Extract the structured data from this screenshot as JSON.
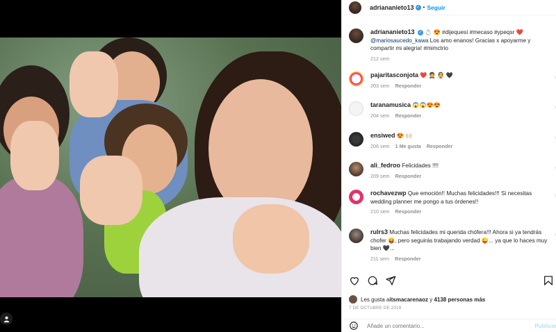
{
  "header": {
    "username": "adriananieto13",
    "follow_label": "Seguir"
  },
  "caption": {
    "username": "adriananieto13",
    "text_prefix": "💍 😍 #dijequesí #mecaso #ypeqsr ❤️ ",
    "mention": "@mariosaucedo_kawa",
    "text_suffix": " Los amo enanos! Gracias x apoyarme y compartir mi alegria! #mimctrio",
    "time": "212 sem"
  },
  "comments": [
    {
      "username": "pajaritasconjota",
      "text": "❤️ 🤵 👰 🖤",
      "time": "203 sem",
      "likes": "",
      "reply": "Responder"
    },
    {
      "username": "taranamusica",
      "text": "😱😱😍😍",
      "time": "204 sem",
      "likes": "",
      "reply": "Responder"
    },
    {
      "username": "ensiwed",
      "text": "😍 🙌🏻",
      "time": "206 sem",
      "likes": "1 Me gusta",
      "reply": "Responder"
    },
    {
      "username": "ali_fedroo",
      "text": "Felicidades !!!!",
      "time": "209 sem",
      "likes": "",
      "reply": "Responder"
    },
    {
      "username": "rochavezwp",
      "text": "Que emoción!! Muchas felicidades!!! Si necesitas wedding planner me pongo a tus órdenes!!",
      "time": "210 sem",
      "likes": "",
      "reply": "Responder"
    },
    {
      "username": "rulrs3",
      "text": "Muchas felicidades mi querida chófera!!! Ahora si ya tendrás chofer 😝, pero seguirás trabajando verdad 😜... ya que lo haces muy bien 🖤...",
      "time": "211 sem",
      "likes": "",
      "reply": "Responder"
    }
  ],
  "likes": {
    "prefix": "Les gusta a ",
    "user": "itsmacarenaoz",
    "middle": " y ",
    "count": "4138 personas más"
  },
  "date": "7 DE OCTUBRE DE 2019",
  "add_comment": {
    "placeholder": "Añade un comentario...",
    "publish_label": "Publicar"
  },
  "icons": [
    "heart-icon",
    "comment-icon",
    "share-icon",
    "bookmark-icon",
    "emoji-icon",
    "user-tag-icon",
    "verified-icon"
  ],
  "colors": {
    "accent": "#0095f6",
    "verified": "#3897f0",
    "text": "#262626",
    "muted": "#8e8e8e",
    "like_red": "#ed4956"
  }
}
